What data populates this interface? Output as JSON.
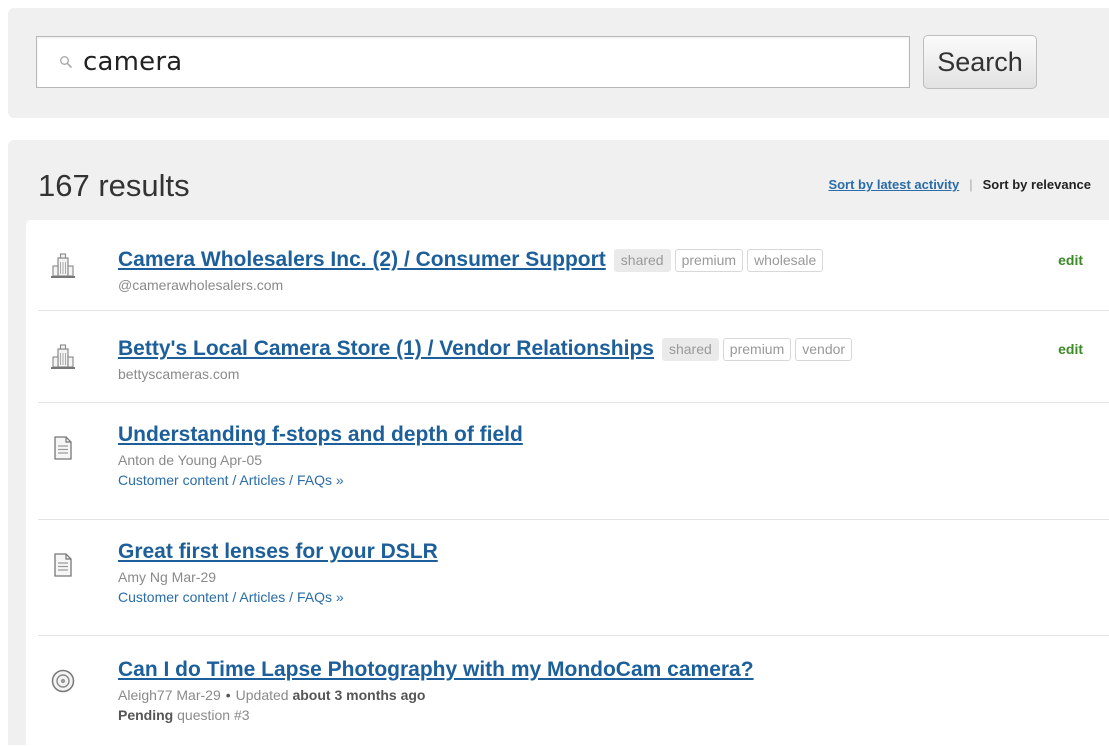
{
  "search": {
    "query": "camera",
    "button_label": "Search"
  },
  "results_header": {
    "count_text": "167 results",
    "sort_latest": "Sort by latest activity",
    "sort_separator": "|",
    "sort_relevance": "Sort by relevance"
  },
  "results": [
    {
      "icon": "building-icon",
      "title": "Camera Wholesalers Inc. (2) / Consumer Support",
      "tags": [
        "shared",
        "premium",
        "wholesale"
      ],
      "subtitle": "@camerawholesalers.com",
      "edit": "edit"
    },
    {
      "icon": "building-icon",
      "title": "Betty's Local Camera Store (1) / Vendor Relationships",
      "tags": [
        "shared",
        "premium",
        "vendor"
      ],
      "subtitle": "bettyscameras.com",
      "edit": "edit"
    },
    {
      "icon": "document-icon",
      "title": "Understanding f-stops and depth of field",
      "meta": "Anton de Young Apr-05",
      "path": "Customer content / Articles / FAQs »"
    },
    {
      "icon": "document-icon",
      "title": "Great first lenses for your DSLR",
      "meta": "Amy Ng Mar-29",
      "path": "Customer content / Articles / FAQs »"
    },
    {
      "icon": "question-icon",
      "title": "Can I do Time Lapse Photography with my MondoCam camera?",
      "meta_author": "Aleigh77 Mar-29",
      "meta_dot": "•",
      "meta_updated_prefix": "Updated",
      "meta_updated_value": "about 3 months ago",
      "status_bold": "Pending",
      "status_rest": "question #3"
    }
  ],
  "colors": {
    "link": "#1d5f9a",
    "edit": "#3b8a26",
    "panel": "#f0f0f0"
  }
}
